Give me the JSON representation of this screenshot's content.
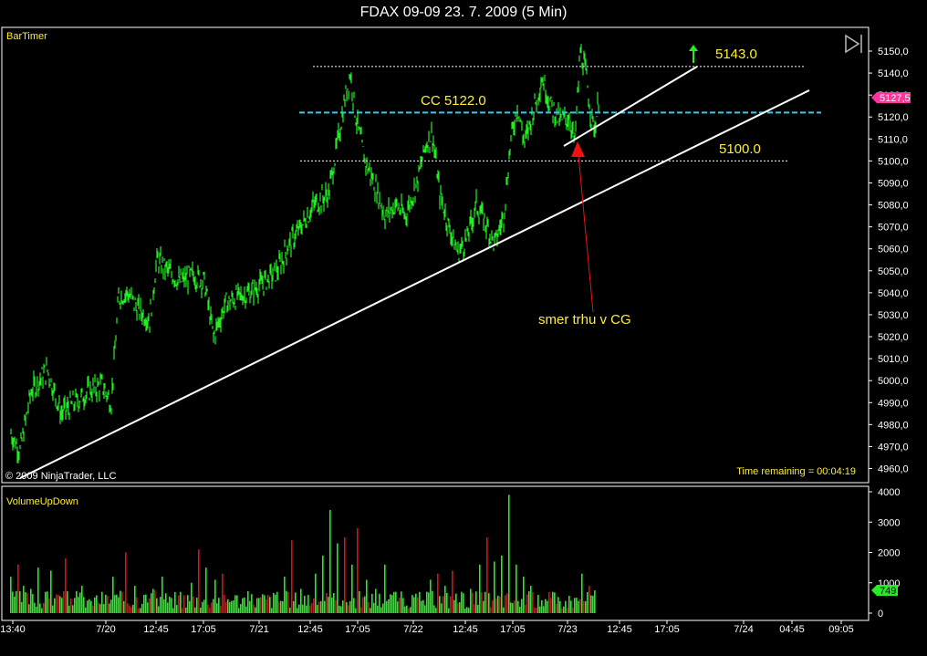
{
  "window": {
    "title": "FDAX 09-09  23. 7. 2009 (5 Min)"
  },
  "price_panel": {
    "indicator_name": "BarTimer",
    "copyright": "© 2009 NinjaTrader, LLC",
    "time_remaining": "Time remaining = 00:04:19",
    "last_price": "5127,5",
    "play_icon": "play-end-icon"
  },
  "volume_panel": {
    "indicator_name": "VolumeUpDown",
    "last_volume": "749"
  },
  "colors": {
    "background": "#000000",
    "price_series": "#22ee22",
    "volume_up": "#22ee22",
    "volume_down": "#dd1111",
    "trendline": "#ffffff",
    "cc_line": "#33ccee",
    "annotation_text": "#ffee33",
    "arrow_red": "#ee1111",
    "price_marker": "#ff3399"
  },
  "chart_data": [
    {
      "type": "line",
      "panel": "price",
      "x_tick_labels": [
        "13:40",
        "7/20",
        "12:45",
        "17:05",
        "7/21",
        "12:45",
        "17:05",
        "7/22",
        "12:45",
        "17:05",
        "7/23",
        "12:45",
        "17:05",
        "7/24",
        "04:45",
        "09:05"
      ],
      "y_tick_labels": [
        "4960,0",
        "4970,0",
        "4980,0",
        "4990,0",
        "5000,0",
        "5010,0",
        "5020,0",
        "5030,0",
        "5040,0",
        "5050,0",
        "5060,0",
        "5070,0",
        "5080,0",
        "5090,0",
        "5100,0",
        "5110,0",
        "5120,0",
        "5130,0",
        "5140,0",
        "5150,0"
      ],
      "ylim": [
        4955,
        5154
      ],
      "series": [
        {
          "x": [
            "13:40",
            "7/20",
            "12:45",
            "17:05",
            "7/21",
            "12:45",
            "17:05",
            "7/22",
            "12:45",
            "17:05",
            "7/23"
          ],
          "values": [
            4976,
            4985,
            5045,
            5025,
            5040,
            5088,
            5095,
            5095,
            5070,
            5095,
            5112
          ]
        }
      ],
      "points": [
        [
          0,
          4976
        ],
        [
          10,
          4968
        ],
        [
          22,
          4995
        ],
        [
          40,
          5005
        ],
        [
          55,
          4985
        ],
        [
          70,
          4990
        ],
        [
          85,
          4995
        ],
        [
          100,
          4998
        ],
        [
          110,
          4990
        ],
        [
          118,
          5038
        ],
        [
          128,
          5040
        ],
        [
          140,
          5032
        ],
        [
          152,
          5028
        ],
        [
          160,
          5055
        ],
        [
          172,
          5050
        ],
        [
          185,
          5045
        ],
        [
          200,
          5048
        ],
        [
          212,
          5045
        ],
        [
          222,
          5020
        ],
        [
          235,
          5035
        ],
        [
          248,
          5038
        ],
        [
          262,
          5040
        ],
        [
          278,
          5045
        ],
        [
          292,
          5050
        ],
        [
          305,
          5062
        ],
        [
          318,
          5070
        ],
        [
          332,
          5080
        ],
        [
          348,
          5085
        ],
        [
          358,
          5108
        ],
        [
          366,
          5128
        ],
        [
          372,
          5140
        ],
        [
          378,
          5120
        ],
        [
          388,
          5100
        ],
        [
          398,
          5090
        ],
        [
          410,
          5075
        ],
        [
          422,
          5080
        ],
        [
          432,
          5075
        ],
        [
          445,
          5090
        ],
        [
          455,
          5108
        ],
        [
          462,
          5112
        ],
        [
          470,
          5085
        ],
        [
          480,
          5070
        ],
        [
          490,
          5058
        ],
        [
          500,
          5065
        ],
        [
          510,
          5080
        ],
        [
          520,
          5072
        ],
        [
          530,
          5062
        ],
        [
          540,
          5075
        ],
        [
          548,
          5110
        ],
        [
          555,
          5125
        ],
        [
          563,
          5108
        ],
        [
          572,
          5122
        ],
        [
          582,
          5138
        ],
        [
          592,
          5125
        ],
        [
          602,
          5118
        ],
        [
          612,
          5120
        ],
        [
          618,
          5108
        ],
        [
          624,
          5150
        ],
        [
          630,
          5140
        ],
        [
          636,
          5120
        ],
        [
          640,
          5115
        ],
        [
          644,
          5127
        ]
      ],
      "annotations": [
        {
          "label": "5143.0",
          "value": 5143
        },
        {
          "label": "CC 5122.0",
          "value": 5122
        },
        {
          "label": "5100.0",
          "value": 5100
        },
        {
          "label": "smer trhu v CG"
        }
      ]
    },
    {
      "type": "bar",
      "panel": "volume",
      "y_tick_labels": [
        "0",
        "1000",
        "2000",
        "3000",
        "4000"
      ],
      "ylim": [
        0,
        4000
      ],
      "series": [
        {
          "x": [
            "13:40",
            "7/20",
            "12:45",
            "17:05",
            "7/21",
            "12:45",
            "17:05",
            "7/22",
            "12:45",
            "17:05",
            "7/23"
          ],
          "values": [
            1200,
            900,
            1000,
            1400,
            900,
            1900,
            1300,
            1100,
            1200,
            2800,
            700
          ]
        }
      ],
      "bars": [
        [
          0,
          1200,
          "up"
        ],
        [
          8,
          1600,
          "down"
        ],
        [
          14,
          900,
          "up"
        ],
        [
          22,
          800,
          "up"
        ],
        [
          30,
          1500,
          "up"
        ],
        [
          38,
          700,
          "up"
        ],
        [
          44,
          1400,
          "up"
        ],
        [
          52,
          600,
          "down"
        ],
        [
          60,
          1800,
          "down"
        ],
        [
          70,
          500,
          "up"
        ],
        [
          78,
          900,
          "up"
        ],
        [
          88,
          400,
          "up"
        ],
        [
          100,
          700,
          "up"
        ],
        [
          112,
          1200,
          "up"
        ],
        [
          126,
          2000,
          "down"
        ],
        [
          136,
          900,
          "up"
        ],
        [
          146,
          600,
          "up"
        ],
        [
          156,
          800,
          "up"
        ],
        [
          166,
          1200,
          "up"
        ],
        [
          176,
          500,
          "up"
        ],
        [
          186,
          700,
          "up"
        ],
        [
          198,
          1000,
          "up"
        ],
        [
          206,
          2100,
          "down"
        ],
        [
          214,
          1500,
          "up"
        ],
        [
          224,
          1100,
          "up"
        ],
        [
          232,
          1300,
          "down"
        ],
        [
          242,
          400,
          "up"
        ],
        [
          252,
          300,
          "up"
        ],
        [
          262,
          400,
          "up"
        ],
        [
          272,
          500,
          "up"
        ],
        [
          282,
          600,
          "down"
        ],
        [
          292,
          700,
          "up"
        ],
        [
          300,
          1200,
          "up"
        ],
        [
          308,
          2400,
          "down"
        ],
        [
          318,
          800,
          "up"
        ],
        [
          326,
          600,
          "up"
        ],
        [
          334,
          1300,
          "up"
        ],
        [
          342,
          1900,
          "up"
        ],
        [
          350,
          3400,
          "up"
        ],
        [
          358,
          2300,
          "up"
        ],
        [
          366,
          2500,
          "down"
        ],
        [
          374,
          1600,
          "up"
        ],
        [
          380,
          2800,
          "down"
        ],
        [
          390,
          1100,
          "up"
        ],
        [
          400,
          800,
          "up"
        ],
        [
          410,
          1600,
          "up"
        ],
        [
          420,
          700,
          "up"
        ],
        [
          430,
          500,
          "up"
        ],
        [
          440,
          600,
          "up"
        ],
        [
          450,
          400,
          "up"
        ],
        [
          460,
          1100,
          "up"
        ],
        [
          468,
          1300,
          "down"
        ],
        [
          476,
          900,
          "up"
        ],
        [
          484,
          1400,
          "down"
        ],
        [
          494,
          700,
          "up"
        ],
        [
          504,
          800,
          "up"
        ],
        [
          514,
          1600,
          "up"
        ],
        [
          522,
          2500,
          "down"
        ],
        [
          530,
          1700,
          "up"
        ],
        [
          538,
          1900,
          "up"
        ],
        [
          546,
          3900,
          "up"
        ],
        [
          554,
          1600,
          "up"
        ],
        [
          562,
          1200,
          "up"
        ],
        [
          570,
          900,
          "up"
        ],
        [
          578,
          600,
          "up"
        ],
        [
          588,
          400,
          "up"
        ],
        [
          598,
          300,
          "down"
        ],
        [
          608,
          400,
          "up"
        ],
        [
          618,
          500,
          "up"
        ],
        [
          626,
          1300,
          "up"
        ],
        [
          634,
          900,
          "down"
        ],
        [
          640,
          749,
          "up"
        ]
      ]
    }
  ]
}
